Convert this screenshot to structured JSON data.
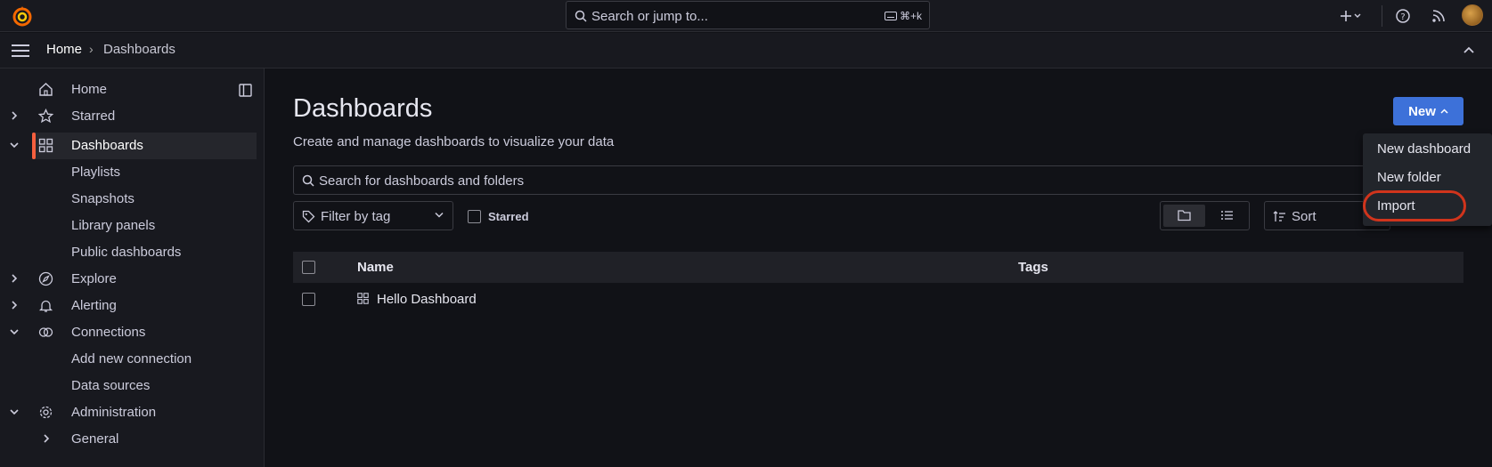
{
  "topbar": {
    "search_placeholder": "Search or jump to...",
    "search_shortcut": "⌘+k",
    "icons": [
      "grafana-logo-icon",
      "keyboard-icon",
      "plus-icon",
      "help-icon",
      "rss-icon",
      "avatar"
    ]
  },
  "breadcrumb": {
    "home": "Home",
    "separator": "›",
    "current": "Dashboards"
  },
  "sidebar": {
    "items": [
      {
        "label": "Home",
        "icon": "home-icon"
      },
      {
        "label": "Starred",
        "icon": "star-icon"
      },
      {
        "label": "Dashboards",
        "icon": "apps-icon"
      },
      {
        "label": "Playlists"
      },
      {
        "label": "Snapshots"
      },
      {
        "label": "Library panels"
      },
      {
        "label": "Public dashboards"
      },
      {
        "label": "Explore",
        "icon": "compass-icon"
      },
      {
        "label": "Alerting",
        "icon": "bell-icon"
      },
      {
        "label": "Connections",
        "icon": "link-icon"
      },
      {
        "label": "Add new connection"
      },
      {
        "label": "Data sources"
      },
      {
        "label": "Administration",
        "icon": "cog-icon"
      },
      {
        "label": "General"
      }
    ]
  },
  "main": {
    "title": "Dashboards",
    "subtitle": "Create and manage dashboards to visualize your data",
    "new_button": "New",
    "search_placeholder": "Search for dashboards and folders",
    "filter_tag_placeholder": "Filter by tag",
    "starred_label": "Starred",
    "sort_placeholder": "Sort",
    "table": {
      "columns": [
        "Name",
        "Tags"
      ],
      "rows": [
        {
          "name": "Hello Dashboard",
          "tags": ""
        }
      ]
    }
  },
  "new_menu": {
    "items": [
      "New dashboard",
      "New folder",
      "Import"
    ]
  },
  "colors": {
    "accent": "#3d71d9",
    "active_bar": "#f55f3e",
    "highlight": "#d0341c"
  }
}
